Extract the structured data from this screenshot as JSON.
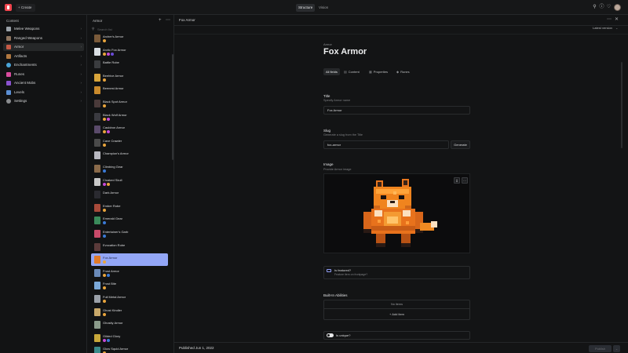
{
  "topbar": {
    "create_label": "+ Create",
    "tabs": [
      {
        "label": "Structure",
        "active": true
      },
      {
        "label": "Vision",
        "active": false
      }
    ],
    "icons": [
      "search-icon",
      "help-icon",
      "user-icon",
      "bell-icon"
    ]
  },
  "nav": {
    "title": "Content",
    "items": [
      {
        "label": "Melee Weapons",
        "icon": "sword-icon",
        "color": "#9aa1a8",
        "active": false
      },
      {
        "label": "Ranged Weapons",
        "icon": "bow-icon",
        "color": "#8e7560",
        "active": false
      },
      {
        "label": "Armor",
        "icon": "armor-icon",
        "color": "#c65a46",
        "active": true
      },
      {
        "label": "Artifacts",
        "icon": "artifact-icon",
        "color": "#b07840",
        "active": false
      },
      {
        "label": "Enchantments",
        "icon": "enchantment-icon",
        "color": "#4aa5d8",
        "active": false
      },
      {
        "label": "Runes",
        "icon": "rune-icon",
        "color": "#d94c9e",
        "active": false
      },
      {
        "label": "Ancient Mobs",
        "icon": "mob-icon",
        "color": "#8a52cf",
        "active": false
      },
      {
        "label": "Levels",
        "icon": "levels-icon",
        "color": "#5b8fd4",
        "active": false
      },
      {
        "label": "Settings",
        "icon": "gear-icon",
        "color": "#8a8c8f",
        "active": false
      }
    ]
  },
  "doclist": {
    "title": "Armor",
    "search_placeholder": "Search list",
    "items": [
      {
        "name": "Archer's Armor",
        "thumb": "#7a5a3a",
        "badges": [
          "#e8a43c"
        ]
      },
      {
        "name": "Arctic Fox Armor",
        "thumb": "#d8dde2",
        "badges": [
          "#e8a43c",
          "#c64ad6",
          "#6a4ad6"
        ]
      },
      {
        "name": "Battle Robe",
        "thumb": "#3a3c3f",
        "badges": []
      },
      {
        "name": "Beehive Armor",
        "thumb": "#d8a43a",
        "badges": [
          "#e8a43c"
        ]
      },
      {
        "name": "Beenest Armor",
        "thumb": "#c98a2c",
        "badges": []
      },
      {
        "name": "Black Spot Armor",
        "thumb": "#4a3a3a",
        "badges": [
          "#e8a43c"
        ]
      },
      {
        "name": "Black Wolf Armor",
        "thumb": "#3a3a40",
        "badges": [
          "#e8a43c",
          "#c64ad6"
        ]
      },
      {
        "name": "Cauldron Armor",
        "thumb": "#5a4a6a",
        "badges": [
          "#e8a43c",
          "#c64ad6"
        ]
      },
      {
        "name": "Cave Crawler",
        "thumb": "#4a4a4a",
        "badges": [
          "#e8a43c"
        ]
      },
      {
        "name": "Champion's Armor",
        "thumb": "#b8b8c0",
        "badges": []
      },
      {
        "name": "Climbing Gear",
        "thumb": "#8a6a4a",
        "badges": [
          "#3a7ad6"
        ]
      },
      {
        "name": "Cloaked Skull",
        "thumb": "#c8c8c8",
        "badges": [
          "#c64ad6",
          "#e8a43c"
        ]
      },
      {
        "name": "Dark Armor",
        "thumb": "#2a2a30",
        "badges": []
      },
      {
        "name": "Ember Robe",
        "thumb": "#a84a3a",
        "badges": [
          "#e8a43c"
        ]
      },
      {
        "name": "Emerald Gear",
        "thumb": "#3a8a5a",
        "badges": [
          "#3a7ad6"
        ]
      },
      {
        "name": "Entertainer's Garb",
        "thumb": "#c84a6a",
        "badges": [
          "#3a7ad6"
        ]
      },
      {
        "name": "Evocation Robe",
        "thumb": "#5a3a3a",
        "badges": []
      },
      {
        "name": "Fox Armor",
        "thumb": "#e07a2a",
        "badges": [
          "#e8a43c"
        ]
      },
      {
        "name": "Frost Armor",
        "thumb": "#6a8ab8",
        "badges": [
          "#e8a43c",
          "#3a7ad6"
        ]
      },
      {
        "name": "Frost Bite",
        "thumb": "#7aa8d8",
        "badges": [
          "#e8a43c"
        ]
      },
      {
        "name": "Full Metal Armor",
        "thumb": "#9aa0a8",
        "badges": [
          "#e8a43c"
        ]
      },
      {
        "name": "Ghost Kindler",
        "thumb": "#c8a86a",
        "badges": [
          "#e8a43c"
        ]
      },
      {
        "name": "Ghostly Armor",
        "thumb": "#8a9a8a",
        "badges": []
      },
      {
        "name": "Gilded Glory",
        "thumb": "#c8a83a",
        "badges": [
          "#c64ad6",
          "#3a7ad6"
        ]
      },
      {
        "name": "Glow Squid Armor",
        "thumb": "#3a8a8a",
        "badges": [
          "#e8a43c"
        ]
      }
    ],
    "active_index": 17
  },
  "editor": {
    "header_title": "Fox Armor",
    "version_label": "Latest version",
    "doc_type": "Armor",
    "doc_title": "Fox Armor",
    "tabs": [
      {
        "label": "All fields",
        "icon": "",
        "active": true
      },
      {
        "label": "Content",
        "icon": "document-icon",
        "active": false
      },
      {
        "label": "Properties",
        "icon": "properties-icon",
        "active": false
      },
      {
        "label": "Runes",
        "icon": "rune-icon",
        "active": false
      }
    ],
    "title_field": {
      "label": "Title",
      "desc": "Specify Armor name",
      "value": "Fox Armor"
    },
    "slug_field": {
      "label": "Slug",
      "desc": "Generate a slug from the Title",
      "value": "fox-armor",
      "button": "Generate"
    },
    "image_field": {
      "label": "Image",
      "desc": "Provide Armor image"
    },
    "featured": {
      "label": "Is featured?",
      "desc": "Feature item on frontpage?"
    },
    "abilities": {
      "label": "Built-In Abilities",
      "empty": "No items",
      "add": "+ Add item"
    },
    "unique": {
      "label": "Is unique?"
    },
    "published": "Published Jun 1, 2022",
    "publish_button": "Publish"
  }
}
